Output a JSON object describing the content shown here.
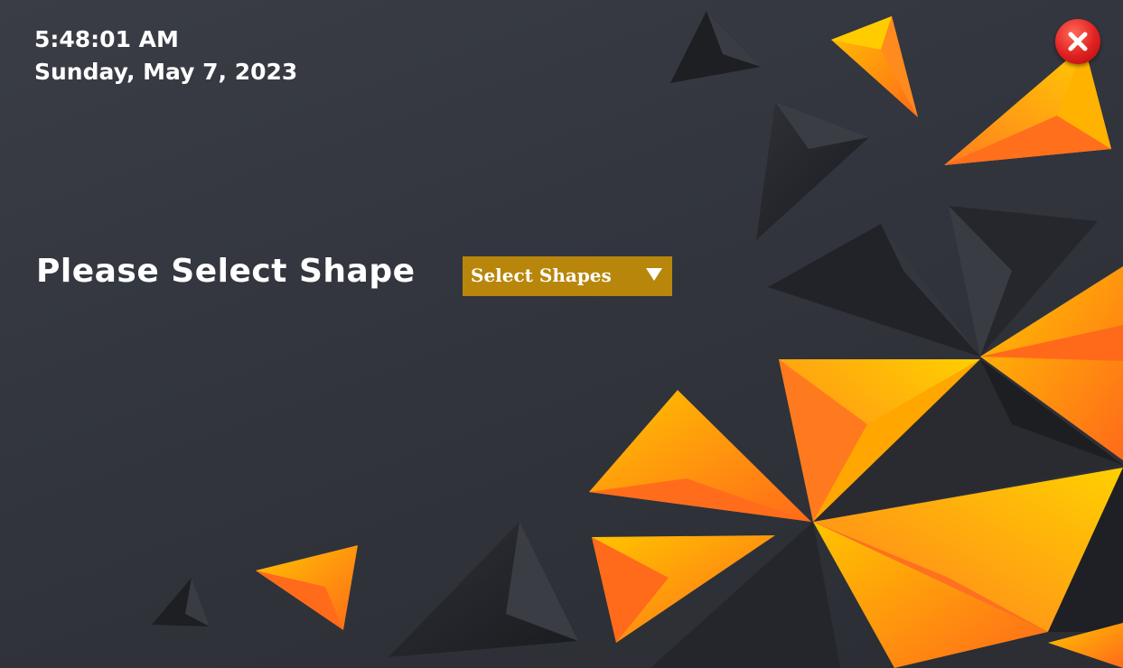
{
  "clock": {
    "time": "5:48:01 AM",
    "date": "Sunday, May 7, 2023"
  },
  "prompt": {
    "label": "Please Select Shape"
  },
  "shape_select": {
    "selected": "Select Shapes"
  },
  "colors": {
    "background": "#32353d",
    "accent_orange": "#ff7a1a",
    "accent_yellow": "#ffc107",
    "dropdown": "#b8860b",
    "close": "#e02020"
  },
  "icons": {
    "close": "close-icon",
    "dropdown": "chevron-down-icon"
  }
}
